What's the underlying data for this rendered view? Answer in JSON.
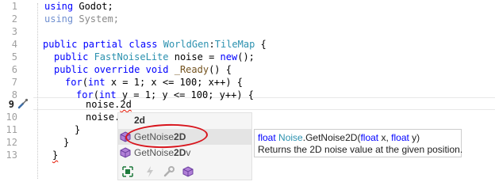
{
  "line_numbers": [
    "1",
    "2",
    "3",
    "4",
    "5",
    "6",
    "7",
    "8",
    "9",
    "10",
    "11",
    "12",
    "13"
  ],
  "current_line": "9",
  "code": {
    "l1_kw": "using",
    "l1_rest": " Godot;",
    "l2_kw": "using",
    "l2_rest": " System;",
    "l4_a": "public partial class ",
    "l4_cls": "WorldGen",
    "l4_sep": ":",
    "l4_base": "TileMap",
    "l4_b": " {",
    "l5_a": "public ",
    "l5_ty": "FastNoiseLite",
    "l5_b": " noise = ",
    "l5_new": "new",
    "l5_c": "();",
    "l6_a": "public override void ",
    "l6_fn": "_Ready",
    "l6_b": "() {",
    "l7_a": "for",
    "l7_b": "(",
    "l7_int": "int",
    "l7_c": " x = 1; x <= 100; x++) {",
    "l8_a": "for",
    "l8_b": "(",
    "l8_int": "int",
    "l8_c": " y = 1; y <= 100; y++) {",
    "l9_a": "noise.",
    "l9_b": "2d",
    "l10": "noise.",
    "l11": "}",
    "l12": "}",
    "l13": "}"
  },
  "completion": {
    "header": "2d",
    "items": [
      {
        "prefix": "GetNoise",
        "bold": "2D",
        "suffix": ""
      },
      {
        "prefix": "GetNoise",
        "bold": "2D",
        "suffix": "v"
      }
    ]
  },
  "tooltip": {
    "ret": "float",
    "cls": "Noise",
    "dot": ".",
    "method": "GetNoise2D",
    "open": "(",
    "p1_type": "float",
    "p1_name": " x, ",
    "p2_type": "float",
    "p2_name": " y",
    "close": ")",
    "description": "Returns the 2D noise value at the given position."
  },
  "colors": {
    "keyword": "#0000ff",
    "type": "#2b91af",
    "error_squiggle": "#e51400",
    "annotation_oval": "#d8141c"
  }
}
